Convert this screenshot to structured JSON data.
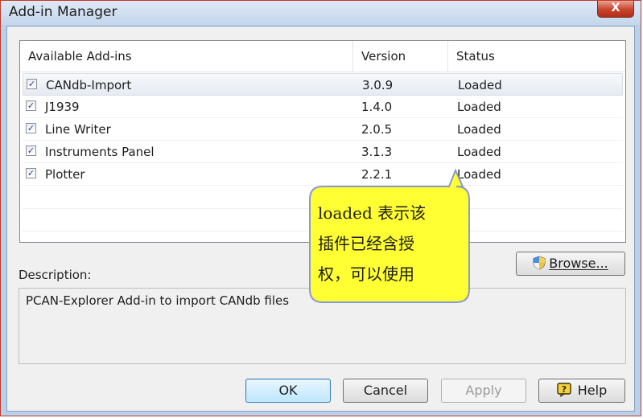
{
  "window": {
    "title": "Add-in Manager",
    "close_label": "X"
  },
  "list": {
    "headers": [
      "Available Add-ins",
      "Version",
      "Status"
    ],
    "rows": [
      {
        "name": "CANdb-Import",
        "version": "3.0.9",
        "status": "Loaded",
        "checked": true,
        "selected": true
      },
      {
        "name": "J1939",
        "version": "1.4.0",
        "status": "Loaded",
        "checked": true,
        "selected": false
      },
      {
        "name": "Line Writer",
        "version": "2.0.5",
        "status": "Loaded",
        "checked": true,
        "selected": false
      },
      {
        "name": "Instruments Panel",
        "version": "3.1.3",
        "status": "Loaded",
        "checked": true,
        "selected": false
      },
      {
        "name": "Plotter",
        "version": "2.2.1",
        "status": "Loaded",
        "checked": true,
        "selected": false
      }
    ]
  },
  "description": {
    "label": "Description:",
    "text": "PCAN-Explorer Add-in to import CANdb files"
  },
  "buttons": {
    "browse": "Browse...",
    "ok": "OK",
    "cancel": "Cancel",
    "apply": "Apply",
    "help": "Help"
  },
  "annotation": {
    "lines": [
      "loaded 表示该",
      "插件已经含授",
      "权，可以使用"
    ]
  },
  "colors": {
    "callout_fill": "#ffff33",
    "callout_border": "#8b9bc7",
    "window_frame": "#b9d1ea",
    "close_button": "#c7432b"
  },
  "icons": {
    "browse": "uac-shield-icon",
    "help": "help-icon",
    "close": "close-icon",
    "checkbox": "checkbox-checked-icon"
  }
}
